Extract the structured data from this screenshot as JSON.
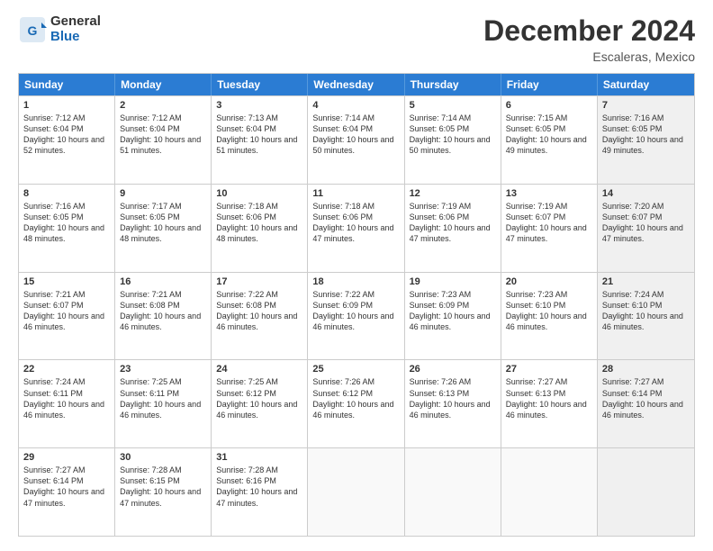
{
  "logo": {
    "line1": "General",
    "line2": "Blue"
  },
  "title": "December 2024",
  "location": "Escaleras, Mexico",
  "header_days": [
    "Sunday",
    "Monday",
    "Tuesday",
    "Wednesday",
    "Thursday",
    "Friday",
    "Saturday"
  ],
  "rows": [
    [
      {
        "day": "1",
        "sunrise": "Sunrise: 7:12 AM",
        "sunset": "Sunset: 6:04 PM",
        "daylight": "Daylight: 10 hours and 52 minutes.",
        "shaded": false
      },
      {
        "day": "2",
        "sunrise": "Sunrise: 7:12 AM",
        "sunset": "Sunset: 6:04 PM",
        "daylight": "Daylight: 10 hours and 51 minutes.",
        "shaded": false
      },
      {
        "day": "3",
        "sunrise": "Sunrise: 7:13 AM",
        "sunset": "Sunset: 6:04 PM",
        "daylight": "Daylight: 10 hours and 51 minutes.",
        "shaded": false
      },
      {
        "day": "4",
        "sunrise": "Sunrise: 7:14 AM",
        "sunset": "Sunset: 6:04 PM",
        "daylight": "Daylight: 10 hours and 50 minutes.",
        "shaded": false
      },
      {
        "day": "5",
        "sunrise": "Sunrise: 7:14 AM",
        "sunset": "Sunset: 6:05 PM",
        "daylight": "Daylight: 10 hours and 50 minutes.",
        "shaded": false
      },
      {
        "day": "6",
        "sunrise": "Sunrise: 7:15 AM",
        "sunset": "Sunset: 6:05 PM",
        "daylight": "Daylight: 10 hours and 49 minutes.",
        "shaded": false
      },
      {
        "day": "7",
        "sunrise": "Sunrise: 7:16 AM",
        "sunset": "Sunset: 6:05 PM",
        "daylight": "Daylight: 10 hours and 49 minutes.",
        "shaded": true
      }
    ],
    [
      {
        "day": "8",
        "sunrise": "Sunrise: 7:16 AM",
        "sunset": "Sunset: 6:05 PM",
        "daylight": "Daylight: 10 hours and 48 minutes.",
        "shaded": false
      },
      {
        "day": "9",
        "sunrise": "Sunrise: 7:17 AM",
        "sunset": "Sunset: 6:05 PM",
        "daylight": "Daylight: 10 hours and 48 minutes.",
        "shaded": false
      },
      {
        "day": "10",
        "sunrise": "Sunrise: 7:18 AM",
        "sunset": "Sunset: 6:06 PM",
        "daylight": "Daylight: 10 hours and 48 minutes.",
        "shaded": false
      },
      {
        "day": "11",
        "sunrise": "Sunrise: 7:18 AM",
        "sunset": "Sunset: 6:06 PM",
        "daylight": "Daylight: 10 hours and 47 minutes.",
        "shaded": false
      },
      {
        "day": "12",
        "sunrise": "Sunrise: 7:19 AM",
        "sunset": "Sunset: 6:06 PM",
        "daylight": "Daylight: 10 hours and 47 minutes.",
        "shaded": false
      },
      {
        "day": "13",
        "sunrise": "Sunrise: 7:19 AM",
        "sunset": "Sunset: 6:07 PM",
        "daylight": "Daylight: 10 hours and 47 minutes.",
        "shaded": false
      },
      {
        "day": "14",
        "sunrise": "Sunrise: 7:20 AM",
        "sunset": "Sunset: 6:07 PM",
        "daylight": "Daylight: 10 hours and 47 minutes.",
        "shaded": true
      }
    ],
    [
      {
        "day": "15",
        "sunrise": "Sunrise: 7:21 AM",
        "sunset": "Sunset: 6:07 PM",
        "daylight": "Daylight: 10 hours and 46 minutes.",
        "shaded": false
      },
      {
        "day": "16",
        "sunrise": "Sunrise: 7:21 AM",
        "sunset": "Sunset: 6:08 PM",
        "daylight": "Daylight: 10 hours and 46 minutes.",
        "shaded": false
      },
      {
        "day": "17",
        "sunrise": "Sunrise: 7:22 AM",
        "sunset": "Sunset: 6:08 PM",
        "daylight": "Daylight: 10 hours and 46 minutes.",
        "shaded": false
      },
      {
        "day": "18",
        "sunrise": "Sunrise: 7:22 AM",
        "sunset": "Sunset: 6:09 PM",
        "daylight": "Daylight: 10 hours and 46 minutes.",
        "shaded": false
      },
      {
        "day": "19",
        "sunrise": "Sunrise: 7:23 AM",
        "sunset": "Sunset: 6:09 PM",
        "daylight": "Daylight: 10 hours and 46 minutes.",
        "shaded": false
      },
      {
        "day": "20",
        "sunrise": "Sunrise: 7:23 AM",
        "sunset": "Sunset: 6:10 PM",
        "daylight": "Daylight: 10 hours and 46 minutes.",
        "shaded": false
      },
      {
        "day": "21",
        "sunrise": "Sunrise: 7:24 AM",
        "sunset": "Sunset: 6:10 PM",
        "daylight": "Daylight: 10 hours and 46 minutes.",
        "shaded": true
      }
    ],
    [
      {
        "day": "22",
        "sunrise": "Sunrise: 7:24 AM",
        "sunset": "Sunset: 6:11 PM",
        "daylight": "Daylight: 10 hours and 46 minutes.",
        "shaded": false
      },
      {
        "day": "23",
        "sunrise": "Sunrise: 7:25 AM",
        "sunset": "Sunset: 6:11 PM",
        "daylight": "Daylight: 10 hours and 46 minutes.",
        "shaded": false
      },
      {
        "day": "24",
        "sunrise": "Sunrise: 7:25 AM",
        "sunset": "Sunset: 6:12 PM",
        "daylight": "Daylight: 10 hours and 46 minutes.",
        "shaded": false
      },
      {
        "day": "25",
        "sunrise": "Sunrise: 7:26 AM",
        "sunset": "Sunset: 6:12 PM",
        "daylight": "Daylight: 10 hours and 46 minutes.",
        "shaded": false
      },
      {
        "day": "26",
        "sunrise": "Sunrise: 7:26 AM",
        "sunset": "Sunset: 6:13 PM",
        "daylight": "Daylight: 10 hours and 46 minutes.",
        "shaded": false
      },
      {
        "day": "27",
        "sunrise": "Sunrise: 7:27 AM",
        "sunset": "Sunset: 6:13 PM",
        "daylight": "Daylight: 10 hours and 46 minutes.",
        "shaded": false
      },
      {
        "day": "28",
        "sunrise": "Sunrise: 7:27 AM",
        "sunset": "Sunset: 6:14 PM",
        "daylight": "Daylight: 10 hours and 46 minutes.",
        "shaded": true
      }
    ],
    [
      {
        "day": "29",
        "sunrise": "Sunrise: 7:27 AM",
        "sunset": "Sunset: 6:14 PM",
        "daylight": "Daylight: 10 hours and 47 minutes.",
        "shaded": false
      },
      {
        "day": "30",
        "sunrise": "Sunrise: 7:28 AM",
        "sunset": "Sunset: 6:15 PM",
        "daylight": "Daylight: 10 hours and 47 minutes.",
        "shaded": false
      },
      {
        "day": "31",
        "sunrise": "Sunrise: 7:28 AM",
        "sunset": "Sunset: 6:16 PM",
        "daylight": "Daylight: 10 hours and 47 minutes.",
        "shaded": false
      },
      {
        "day": "",
        "sunrise": "",
        "sunset": "",
        "daylight": "",
        "shaded": false,
        "empty": true
      },
      {
        "day": "",
        "sunrise": "",
        "sunset": "",
        "daylight": "",
        "shaded": false,
        "empty": true
      },
      {
        "day": "",
        "sunrise": "",
        "sunset": "",
        "daylight": "",
        "shaded": false,
        "empty": true
      },
      {
        "day": "",
        "sunrise": "",
        "sunset": "",
        "daylight": "",
        "shaded": true,
        "empty": true
      }
    ]
  ]
}
